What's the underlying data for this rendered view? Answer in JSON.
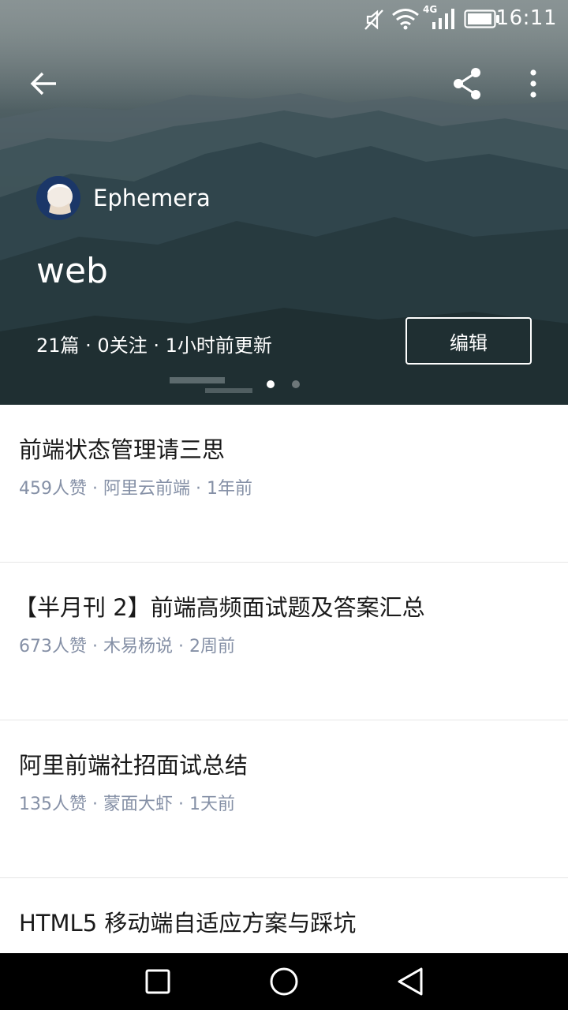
{
  "status_bar": {
    "time": "16:11",
    "network": "4G",
    "icons": [
      "mute-icon",
      "wifi-icon",
      "signal-icon",
      "battery-icon"
    ]
  },
  "toolbar": {
    "icons": [
      "back-arrow-icon",
      "share-icon",
      "more-vertical-icon"
    ]
  },
  "column": {
    "author": "Ephemera",
    "title": "web",
    "meta": "21篇 · 0关注 · 1小时前更新",
    "edit_label": "编辑",
    "page_dots": 2,
    "active_dot": 0
  },
  "articles": [
    {
      "title": "前端状态管理请三思",
      "meta": "459人赞 · 阿里云前端 · 1年前"
    },
    {
      "title": "【半月刊 2】前端高频面试题及答案汇总",
      "meta": "673人赞 · 木易杨说 · 2周前"
    },
    {
      "title": "阿里前端社招面试总结",
      "meta": "135人赞 · 蒙面大虾 · 1天前"
    },
    {
      "title": "HTML5 移动端自适应方案与踩坑",
      "meta": ""
    }
  ],
  "nav_bar": {
    "icons": [
      "recents-square-icon",
      "home-circle-icon",
      "back-triangle-icon"
    ]
  },
  "colors": {
    "hero_dark": "#243539",
    "meta_gray": "#8590a6",
    "title_text": "#1a1a1a",
    "divider": "#e6e6e6"
  }
}
